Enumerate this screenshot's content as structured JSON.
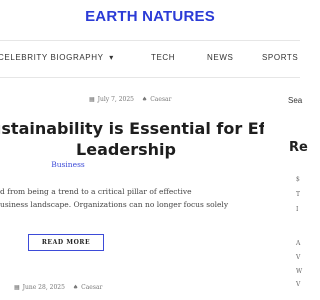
{
  "site": {
    "title": "EARTH NATURES"
  },
  "nav": {
    "items": [
      "CELEBRITY BIOGRAPHY",
      "TECH",
      "NEWS",
      "SPORTS"
    ],
    "dropdown_arrow": "▾"
  },
  "post": {
    "date": "July 7, 2025",
    "author": "Caesar",
    "title_line1": "ustainability is Essential for Effective",
    "title_line2": "Leadership",
    "category": "Business",
    "excerpt_line1": "d from being a trend to a critical pillar of effective",
    "excerpt_line2": "usiness landscape. Organizations can no longer focus solely",
    "read_more": "READ MORE"
  },
  "next_post": {
    "date": "June 28, 2025",
    "author": "Caesar"
  },
  "sidebar": {
    "search_label": "Sea",
    "heading": "Re",
    "glyphs": [
      "$",
      "T",
      "I",
      "A",
      "V",
      "W",
      "V"
    ]
  },
  "icons": {
    "calendar": "calendar-icon",
    "author": "user-icon"
  },
  "colors": {
    "accent": "#2b3bd6",
    "text": "#1e1e1e",
    "meta": "#777777"
  }
}
